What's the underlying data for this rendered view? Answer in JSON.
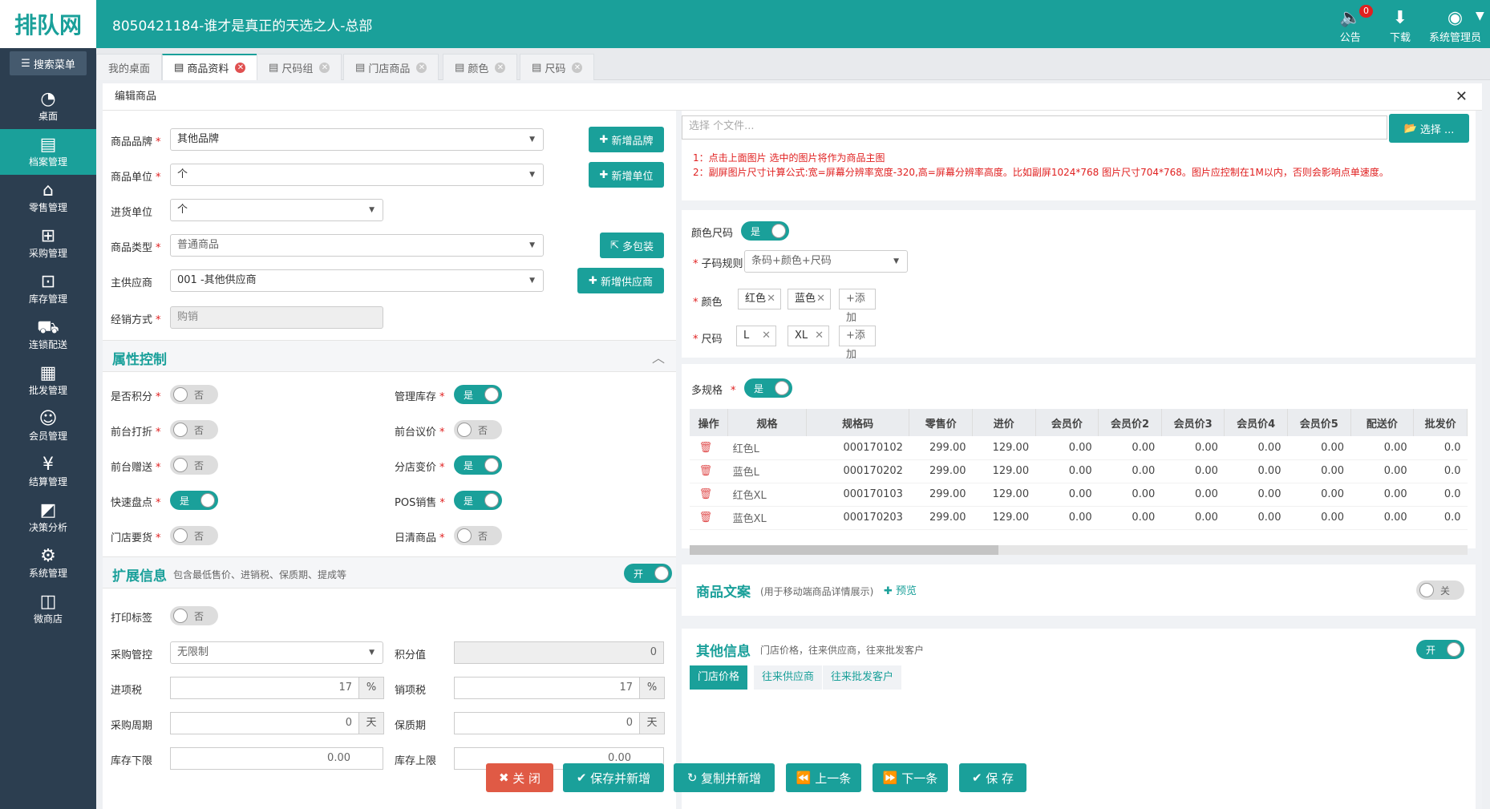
{
  "header": {
    "logo": "排队网",
    "title": "8050421184-谁才是真正的天选之人-总部",
    "notice": "公告",
    "notice_count": "0",
    "download": "下载",
    "user": "系统管理员"
  },
  "sidebar": {
    "search": "搜索菜单",
    "items": [
      {
        "label": "桌面",
        "icon": "dashboard-icon"
      },
      {
        "label": "档案管理",
        "icon": "archive-icon"
      },
      {
        "label": "零售管理",
        "icon": "store-icon"
      },
      {
        "label": "采购管理",
        "icon": "cart-icon"
      },
      {
        "label": "库存管理",
        "icon": "inventory-icon"
      },
      {
        "label": "连锁配送",
        "icon": "truck-icon"
      },
      {
        "label": "批发管理",
        "icon": "wholesale-icon"
      },
      {
        "label": "会员管理",
        "icon": "member-icon"
      },
      {
        "label": "结算管理",
        "icon": "settlement-icon"
      },
      {
        "label": "决策分析",
        "icon": "chart-icon"
      },
      {
        "label": "系统管理",
        "icon": "gear-icon"
      },
      {
        "label": "微商店",
        "icon": "shop-icon"
      }
    ]
  },
  "tabs": [
    "我的桌面",
    "商品资料",
    "尺码组",
    "门店商品",
    "颜色",
    "尺码"
  ],
  "dialog": {
    "title": "编辑商品"
  },
  "form": {
    "brand_label": "商品品牌",
    "brand_value": "其他品牌",
    "add_brand": "新增品牌",
    "unit_label": "商品单位",
    "unit_value": "个",
    "add_unit": "新增单位",
    "purchase_unit_label": "进货单位",
    "purchase_unit_value": "个",
    "type_label": "商品类型",
    "type_value": "普通商品",
    "multi_pack": "多包装",
    "supplier_label": "主供应商",
    "supplier_value": "001 -其他供应商",
    "add_supplier": "新增供应商",
    "mode_label": "经销方式",
    "mode_value": "购销"
  },
  "attr": {
    "title": "属性控制",
    "items": [
      {
        "label": "是否积分",
        "value": "否"
      },
      {
        "label": "管理库存",
        "value": "是"
      },
      {
        "label": "前台打折",
        "value": "否"
      },
      {
        "label": "前台议价",
        "value": "否"
      },
      {
        "label": "前台赠送",
        "value": "否"
      },
      {
        "label": "分店变价",
        "value": "是"
      },
      {
        "label": "快速盘点",
        "value": "是"
      },
      {
        "label": "POS销售",
        "value": "是"
      },
      {
        "label": "门店要货",
        "value": "否"
      },
      {
        "label": "日清商品",
        "value": "否"
      }
    ]
  },
  "ext": {
    "title": "扩展信息",
    "subtitle": "包含最低售价、进销税、保质期、提成等",
    "toggle": "开",
    "print_label": "打印标签",
    "print_value": "否",
    "purchase_ctrl_label": "采购管控",
    "purchase_ctrl_value": "无限制",
    "points_label": "积分值",
    "points_value": "0",
    "in_tax_label": "进项税",
    "in_tax_value": "17",
    "pct": "%",
    "out_tax_label": "销项税",
    "out_tax_value": "17",
    "cycle_label": "采购周期",
    "cycle_value": "0",
    "day": "天",
    "shelf_label": "保质期",
    "shelf_value": "0",
    "min_label": "库存下限",
    "min_value": "0.00",
    "max_label": "库存上限",
    "max_value": "0.00"
  },
  "image": {
    "placeholder": "选择 个文件...",
    "select": "选择 ...",
    "hint1": "1：点击上面图片 选中的图片将作为商品主图",
    "hint2": "2：副屏图片尺寸计算公式:宽=屏幕分辨率宽度-320,高=屏幕分辨率高度。比如副屏1024*768 图片尺寸704*768。图片应控制在1M以内，否则会影响点单速度。"
  },
  "color_size": {
    "label": "颜色尺码",
    "toggle": "是",
    "rule_label": "子码规则",
    "rule_value": "条码+颜色+尺码",
    "color_label": "颜色",
    "colors": [
      "红色",
      "蓝色"
    ],
    "size_label": "尺码",
    "sizes": [
      "L",
      "XL"
    ],
    "add": "+添加"
  },
  "multi": {
    "label": "多规格",
    "toggle": "是",
    "columns": [
      "操作",
      "规格",
      "规格码",
      "零售价",
      "进价",
      "会员价",
      "会员价2",
      "会员价3",
      "会员价4",
      "会员价5",
      "配送价",
      "批发价"
    ],
    "rows": [
      [
        "红色L",
        "000170102",
        "299.00",
        "129.00",
        "0.00",
        "0.00",
        "0.00",
        "0.00",
        "0.00",
        "0.00",
        "0.0"
      ],
      [
        "蓝色L",
        "000170202",
        "299.00",
        "129.00",
        "0.00",
        "0.00",
        "0.00",
        "0.00",
        "0.00",
        "0.00",
        "0.0"
      ],
      [
        "红色XL",
        "000170103",
        "299.00",
        "129.00",
        "0.00",
        "0.00",
        "0.00",
        "0.00",
        "0.00",
        "0.00",
        "0.0"
      ],
      [
        "蓝色XL",
        "000170203",
        "299.00",
        "129.00",
        "0.00",
        "0.00",
        "0.00",
        "0.00",
        "0.00",
        "0.00",
        "0.0"
      ]
    ]
  },
  "copy": {
    "title": "商品文案",
    "subtitle": "(用于移动端商品详情展示)",
    "preview": "预览",
    "toggle": "关"
  },
  "other": {
    "title": "其他信息",
    "subtitle": "门店价格，往来供应商，往来批发客户",
    "toggle": "开",
    "tabs": [
      "门店价格",
      "往来供应商",
      "往来批发客户"
    ]
  },
  "footer": {
    "close": "关 闭",
    "save_new": "保存并新增",
    "copy_new": "复制并新增",
    "prev": "上一条",
    "next": "下一条",
    "save": "保 存"
  }
}
